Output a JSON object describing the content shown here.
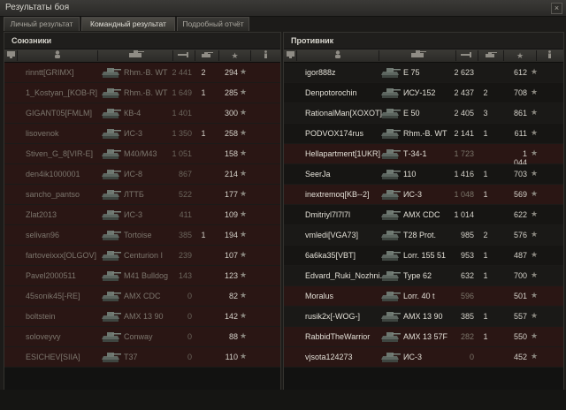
{
  "window": {
    "title": "Результаты боя",
    "close_icon": "×"
  },
  "tabs": [
    {
      "label": "Личный результат"
    },
    {
      "label": "Командный результат"
    },
    {
      "label": "Подробный отчёт"
    }
  ],
  "allies": {
    "title": "Союзники",
    "rows": [
      {
        "name": "rinntt[GRIMX]",
        "vehicle": "Rhm.-B. WT",
        "damage": "2 441",
        "kills": "2",
        "xp": "294",
        "dead": true
      },
      {
        "name": "1_Kostyan_[KOB-R]",
        "vehicle": "Rhm.-B. WT",
        "damage": "1 649",
        "kills": "1",
        "xp": "285",
        "dead": true
      },
      {
        "name": "GIGANT05[FMLM]",
        "vehicle": "КВ-4",
        "damage": "1 401",
        "kills": "",
        "xp": "300",
        "dead": true
      },
      {
        "name": "lisovenok",
        "vehicle": "ИС-3",
        "damage": "1 350",
        "kills": "1",
        "xp": "258",
        "dead": true
      },
      {
        "name": "Stiven_G_8[VIR-E]",
        "vehicle": "M40/M43",
        "damage": "1 051",
        "kills": "",
        "xp": "158",
        "dead": true
      },
      {
        "name": "den4ik1000001",
        "vehicle": "ИС-8",
        "damage": "867",
        "kills": "",
        "xp": "214",
        "dead": true
      },
      {
        "name": "sancho_pantso",
        "vehicle": "ЛТТБ",
        "damage": "522",
        "kills": "",
        "xp": "177",
        "dead": true
      },
      {
        "name": "Zlat2013",
        "vehicle": "ИС-3",
        "damage": "411",
        "kills": "",
        "xp": "109",
        "dead": true
      },
      {
        "name": "selivan96",
        "vehicle": "Tortoise",
        "damage": "385",
        "kills": "1",
        "xp": "194",
        "dead": true
      },
      {
        "name": "fartoveixxx[OLGOV]",
        "vehicle": "Centurion I",
        "damage": "239",
        "kills": "",
        "xp": "107",
        "dead": true
      },
      {
        "name": "Pavel2000511",
        "vehicle": "M41 Bulldog",
        "damage": "143",
        "kills": "",
        "xp": "123",
        "dead": true
      },
      {
        "name": "45sonik45[-RE]",
        "vehicle": "AMX CDC",
        "damage": "0",
        "kills": "",
        "xp": "82",
        "dead": true
      },
      {
        "name": "boltstein",
        "vehicle": "AMX 13 90",
        "damage": "0",
        "kills": "",
        "xp": "142",
        "dead": true
      },
      {
        "name": "soloveyvy",
        "vehicle": "Conway",
        "damage": "0",
        "kills": "",
        "xp": "88",
        "dead": true
      },
      {
        "name": "ESICHEV[SIIA]",
        "vehicle": "T37",
        "damage": "0",
        "kills": "",
        "xp": "110",
        "dead": true
      }
    ]
  },
  "enemies": {
    "title": "Противник",
    "rows": [
      {
        "name": "igor888z",
        "vehicle": "E 75",
        "damage": "2 623",
        "kills": "",
        "xp": "612",
        "dead": false
      },
      {
        "name": "Denpotorochin",
        "vehicle": "ИСУ-152",
        "damage": "2 437",
        "kills": "2",
        "xp": "708",
        "dead": false
      },
      {
        "name": "RationalMan[XOXOT]",
        "vehicle": "E 50",
        "damage": "2 405",
        "kills": "3",
        "xp": "861",
        "dead": false
      },
      {
        "name": "PODVOX174rus",
        "vehicle": "Rhm.-B. WT",
        "damage": "2 141",
        "kills": "1",
        "xp": "611",
        "dead": false
      },
      {
        "name": "Hellapartment[1UKR]",
        "vehicle": "Т-34-1",
        "damage": "1 723",
        "kills": "",
        "xp": "1 044",
        "dead": true
      },
      {
        "name": "SeerJa",
        "vehicle": "110",
        "damage": "1 416",
        "kills": "1",
        "xp": "703",
        "dead": false
      },
      {
        "name": "inextremoq[KB--2]",
        "vehicle": "ИС-3",
        "damage": "1 048",
        "kills": "1",
        "xp": "569",
        "dead": true
      },
      {
        "name": "Dmitriyl7l7l7l",
        "vehicle": "AMX CDC",
        "damage": "1 014",
        "kills": "",
        "xp": "622",
        "dead": false
      },
      {
        "name": "vmledi[VGA73]",
        "vehicle": "T28 Prot.",
        "damage": "985",
        "kills": "2",
        "xp": "576",
        "dead": false
      },
      {
        "name": "6a6ka35[VBT]",
        "vehicle": "Lorr. 155 51",
        "damage": "953",
        "kills": "1",
        "xp": "487",
        "dead": false
      },
      {
        "name": "Edvard_Ruki_Nozhni...",
        "vehicle": "Type 62",
        "damage": "632",
        "kills": "1",
        "xp": "700",
        "dead": false
      },
      {
        "name": "Moralus",
        "vehicle": "Lorr. 40 t",
        "damage": "596",
        "kills": "",
        "xp": "501",
        "dead": true
      },
      {
        "name": "rusik2x[-WOG-]",
        "vehicle": "AMX 13 90",
        "damage": "385",
        "kills": "1",
        "xp": "557",
        "dead": false
      },
      {
        "name": "RabbidTheWarrior",
        "vehicle": "AMX 13 57F",
        "damage": "282",
        "kills": "1",
        "xp": "550",
        "dead": true
      },
      {
        "name": "vjsota124273",
        "vehicle": "ИС-3",
        "damage": "0",
        "kills": "",
        "xp": "452",
        "dead": true
      }
    ]
  },
  "colors": {
    "dead_row": "#2a1614",
    "accent": "#e2dfd6"
  },
  "icons": {
    "star": "★"
  }
}
